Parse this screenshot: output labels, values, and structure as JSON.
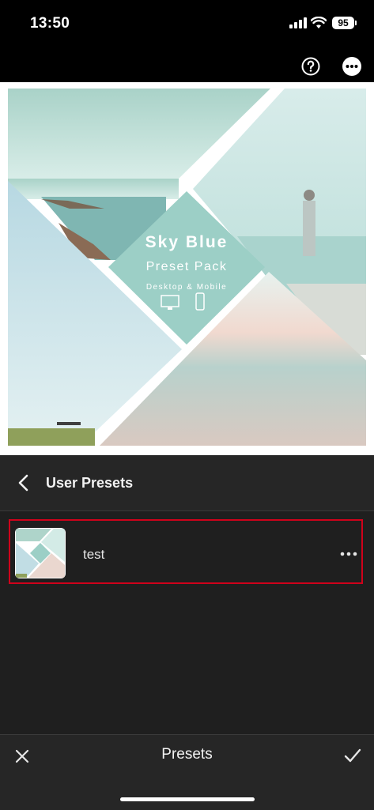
{
  "status_bar": {
    "time": "13:50",
    "battery": "95"
  },
  "toolbar": {
    "help_icon": "help-circle-icon",
    "more_icon": "more-circle-icon"
  },
  "photo": {
    "title": "Sky Blue",
    "subtitle": "Preset Pack",
    "caption": "Desktop & Mobile",
    "accent_color": "#9ccfc6"
  },
  "panel": {
    "title": "User Presets",
    "back_icon": "chevron-left-icon"
  },
  "presets": [
    {
      "name": "test",
      "highlight_color": "#d0021b"
    }
  ],
  "bottom_bar": {
    "title": "Presets",
    "cancel_icon": "close-icon",
    "confirm_icon": "checkmark-icon"
  }
}
